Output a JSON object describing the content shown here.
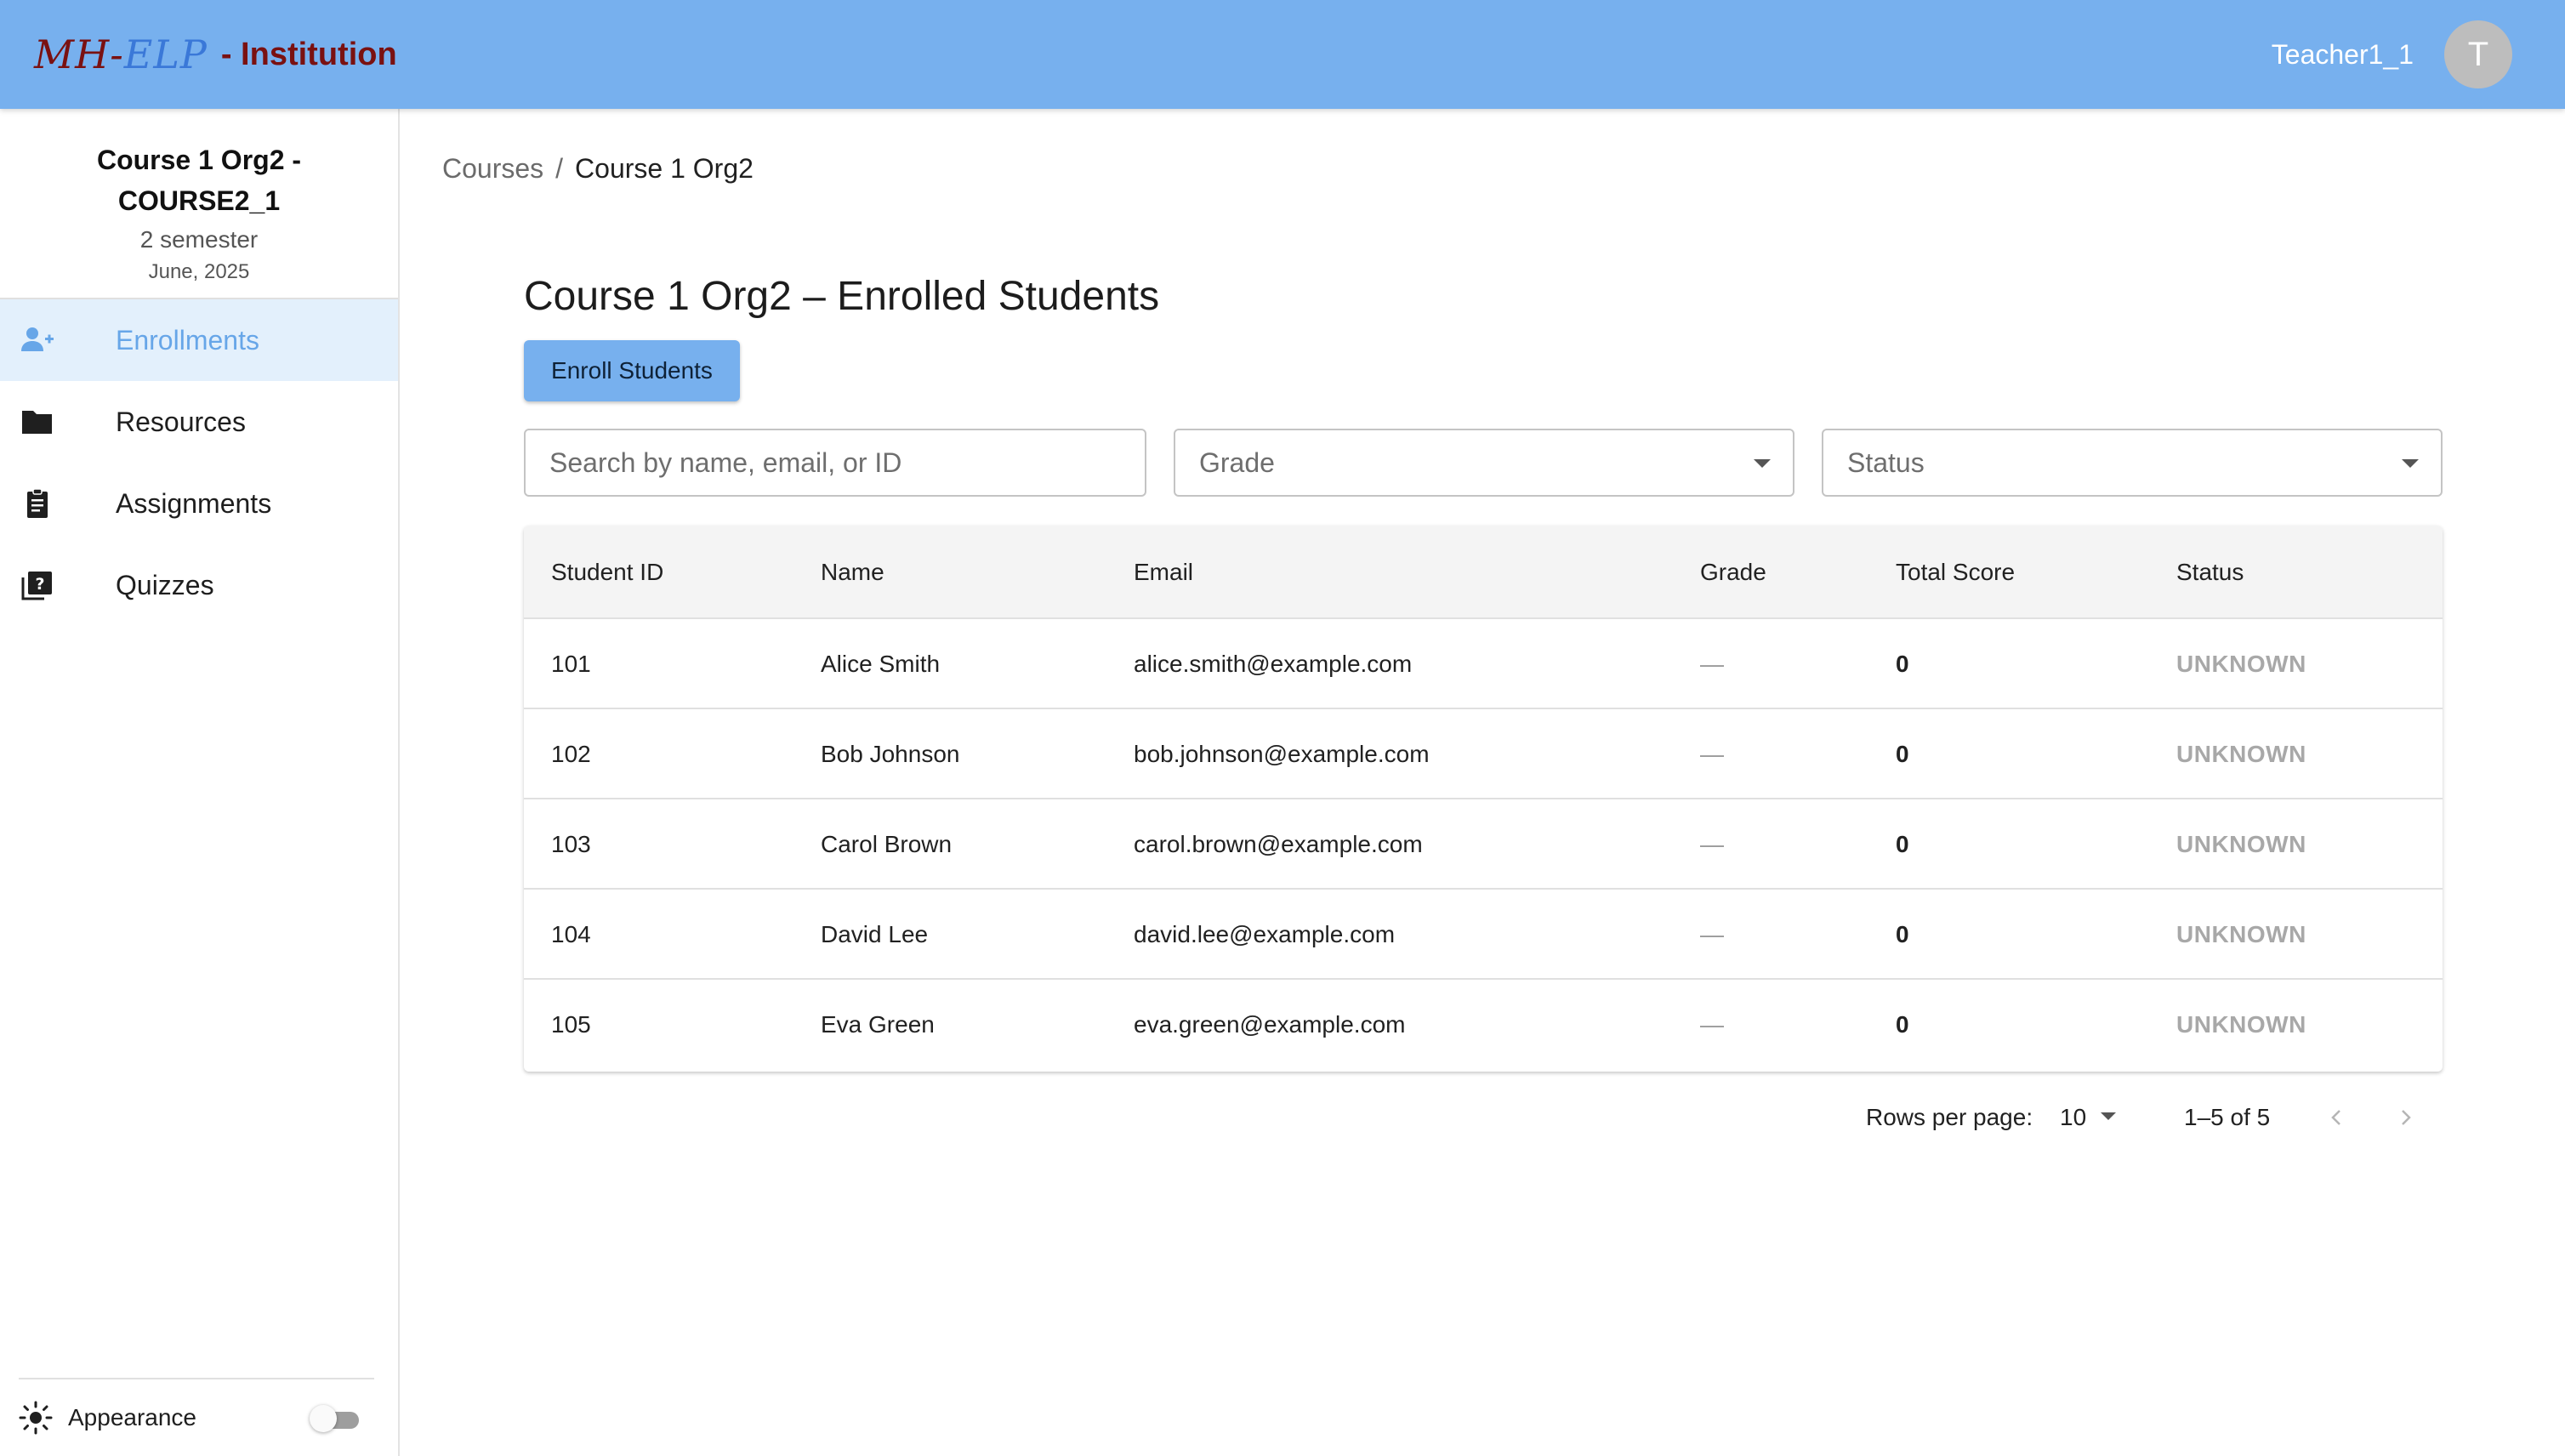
{
  "header": {
    "logo_mh": "MH-",
    "logo_elp": "ELP",
    "logo_suffix": "- Institution",
    "user_name": "Teacher1_1",
    "avatar_initial": "T"
  },
  "sidebar": {
    "course_title": "Course 1 Org2 - COURSE2_1",
    "semester": "2 semester",
    "date": "June, 2025",
    "items": [
      {
        "label": "Enrollments",
        "icon": "person-add-icon",
        "active": true
      },
      {
        "label": "Resources",
        "icon": "folder-icon",
        "active": false
      },
      {
        "label": "Assignments",
        "icon": "clipboard-icon",
        "active": false
      },
      {
        "label": "Quizzes",
        "icon": "quiz-icon",
        "active": false
      }
    ],
    "appearance_label": "Appearance",
    "appearance_dark": false
  },
  "breadcrumb": {
    "parent": "Courses",
    "separator": "/",
    "current": "Course 1 Org2"
  },
  "main": {
    "title": "Course 1 Org2 – Enrolled Students",
    "enroll_button": "Enroll Students"
  },
  "filters": {
    "search_placeholder": "Search by name, email, or ID",
    "grade_label": "Grade",
    "status_label": "Status"
  },
  "table": {
    "columns": [
      "Student ID",
      "Name",
      "Email",
      "Grade",
      "Total Score",
      "Status"
    ],
    "rows": [
      {
        "id": "101",
        "name": "Alice Smith",
        "email": "alice.smith@example.com",
        "grade": "—",
        "score": "0",
        "status": "UNKNOWN"
      },
      {
        "id": "102",
        "name": "Bob Johnson",
        "email": "bob.johnson@example.com",
        "grade": "—",
        "score": "0",
        "status": "UNKNOWN"
      },
      {
        "id": "103",
        "name": "Carol Brown",
        "email": "carol.brown@example.com",
        "grade": "—",
        "score": "0",
        "status": "UNKNOWN"
      },
      {
        "id": "104",
        "name": "David Lee",
        "email": "david.lee@example.com",
        "grade": "—",
        "score": "0",
        "status": "UNKNOWN"
      },
      {
        "id": "105",
        "name": "Eva Green",
        "email": "eva.green@example.com",
        "grade": "—",
        "score": "0",
        "status": "UNKNOWN"
      }
    ]
  },
  "pagination": {
    "rows_per_page_label": "Rows per page:",
    "rows_per_page": "10",
    "range": "1–5 of 5"
  },
  "colors": {
    "header_bg": "#77b0ee",
    "accent": "#67a6e8",
    "active_bg": "#e3f0fc",
    "logo_dark_red": "#7a1111",
    "logo_blue": "#3a78d8",
    "status_gray": "#a8a8a8"
  }
}
